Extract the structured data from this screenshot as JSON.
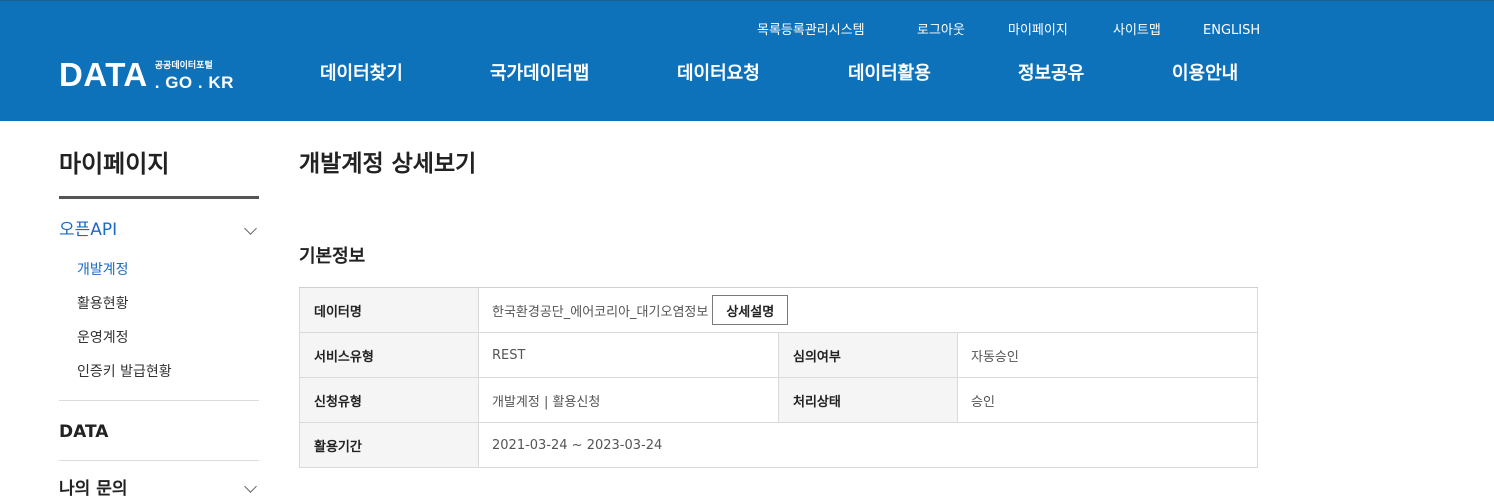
{
  "header": {
    "logo": {
      "main": "DATA",
      "sub": "공공데이터포털",
      "domain": ". GO . KR"
    },
    "utility_links": [
      "목록등록관리시스템",
      "로그아웃",
      "마이페이지",
      "사이트맵",
      "ENGLISH"
    ],
    "nav": [
      "데이터찾기",
      "국가데이터맵",
      "데이터요청",
      "데이터활용",
      "정보공유",
      "이용안내"
    ]
  },
  "sidebar": {
    "title": "마이페이지",
    "sections": [
      {
        "label": "오픈API",
        "state": "expanded",
        "items": [
          "개발계정",
          "활용현황",
          "운영계정",
          "인증키 발급현황"
        ],
        "active_item": "개발계정"
      },
      {
        "label": "DATA"
      },
      {
        "label": "나의 문의"
      }
    ]
  },
  "main": {
    "title": "개발계정 상세보기",
    "section_title": "기본정보",
    "table": {
      "data_name_label": "데이터명",
      "data_name_value": "한국환경공단_에어코리아_대기오염정보",
      "detail_button": "상세설명",
      "service_type_label": "서비스유형",
      "service_type_value": "REST",
      "review_label": "심의여부",
      "review_value": "자동승인",
      "request_type_label": "신청유형",
      "request_type_value": "개발계정 | 활용신청",
      "status_label": "처리상태",
      "status_value": "승인",
      "period_label": "활용기간",
      "period_value": "2021-03-24 ~ 2023-03-24"
    }
  },
  "colors": {
    "header_bg": "#0e72bb",
    "active_link": "#1b6bc0"
  }
}
